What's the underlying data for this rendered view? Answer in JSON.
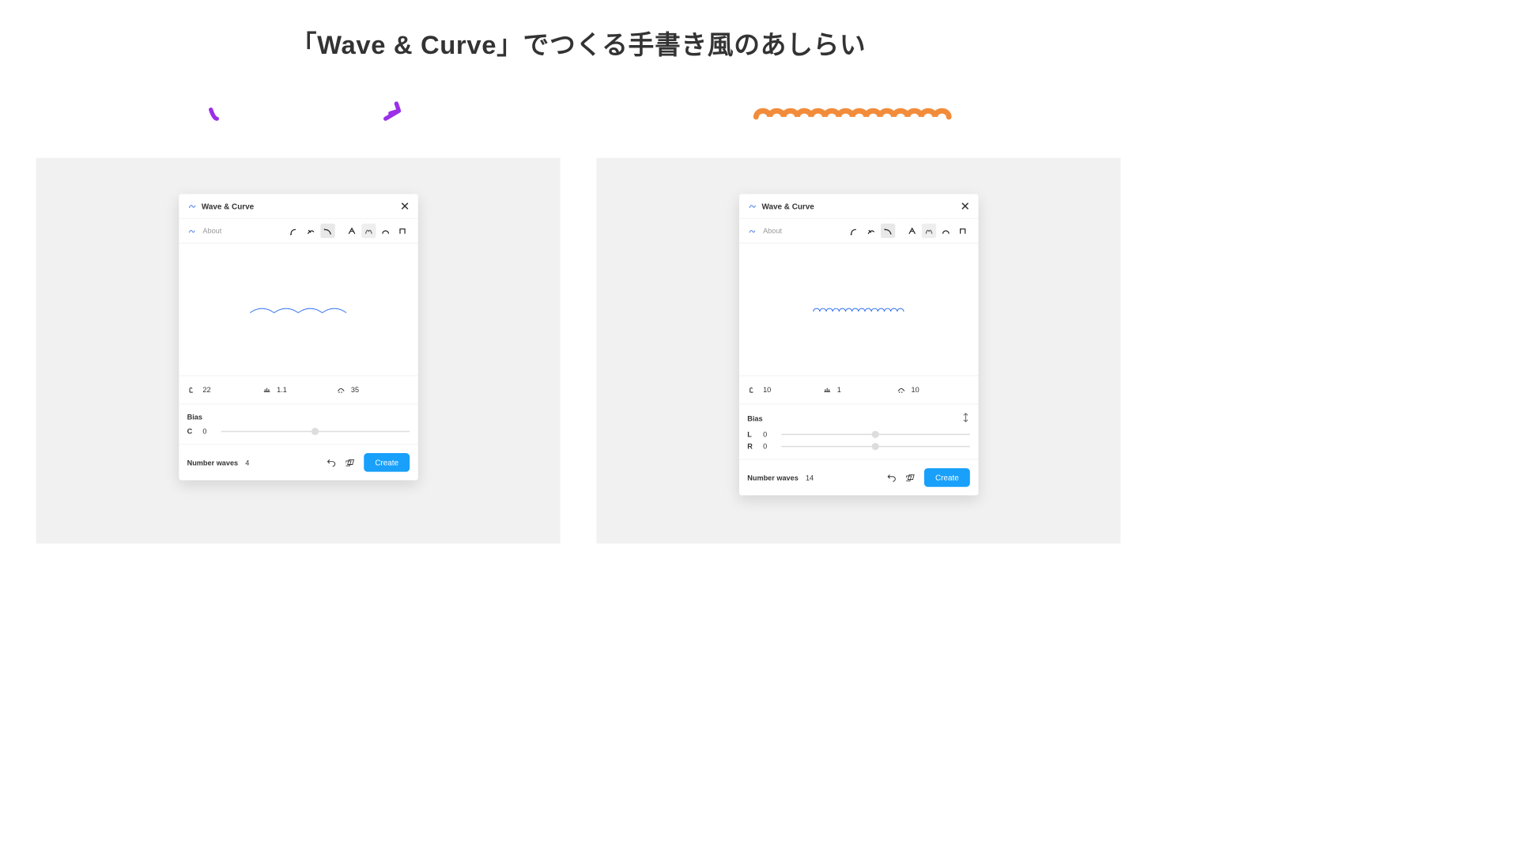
{
  "page_title": "「Wave & Curve」でつくる手書き風のあしらい",
  "left": {
    "plugin_title": "Wave & Curve",
    "about_label": "About",
    "shape_icons": [
      "curve-up",
      "curve-cross",
      "curve-down",
      "peak-a",
      "peak-m",
      "arc",
      "bracket"
    ],
    "active_shape_index": 2,
    "secondary_active_index": 4,
    "params": {
      "amplitude": "22",
      "stroke": "1.1",
      "frequency": "35"
    },
    "bias": {
      "label": "Bias",
      "rows": [
        {
          "key": "C",
          "value": "0",
          "pos": 50
        }
      ]
    },
    "number_waves_label": "Number waves",
    "number_waves": "4",
    "create_label": "Create",
    "preview": {
      "type": "wave",
      "n": 4,
      "amp": 10,
      "width": 160,
      "color": "#2f6fed",
      "stroke": 1.2
    },
    "deco": {
      "color": "#9b2fe8",
      "stroke": 7,
      "arrow": true
    }
  },
  "right": {
    "plugin_title": "Wave & Curve",
    "about_label": "About",
    "shape_icons": [
      "curve-up",
      "curve-cross",
      "curve-down",
      "peak-a",
      "peak-m",
      "arc",
      "bracket"
    ],
    "active_shape_index": 2,
    "secondary_active_index": 4,
    "params": {
      "amplitude": "10",
      "stroke": "1",
      "frequency": "10"
    },
    "bias": {
      "label": "Bias",
      "rows": [
        {
          "key": "L",
          "value": "0",
          "pos": 50
        },
        {
          "key": "R",
          "value": "0",
          "pos": 50
        }
      ],
      "expand": true
    },
    "number_waves_label": "Number waves",
    "number_waves": "14",
    "create_label": "Create",
    "preview": {
      "type": "bumps",
      "n": 14,
      "amp": 5,
      "width": 150,
      "color": "#2f6fed",
      "stroke": 1.2
    },
    "deco": {
      "color": "#f28c3b",
      "stroke": 9
    }
  }
}
